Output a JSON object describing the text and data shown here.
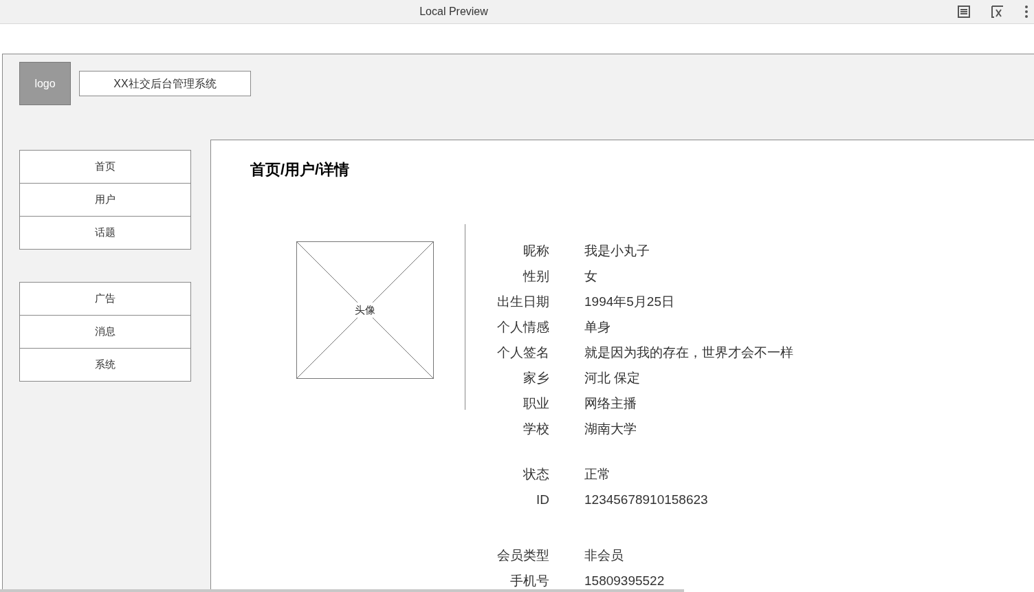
{
  "window": {
    "title": "Local Preview"
  },
  "header": {
    "logo": "logo",
    "system_name": "XX社交后台管理系统"
  },
  "sidebar": {
    "groups": [
      {
        "items": [
          {
            "label": "首页"
          },
          {
            "label": "用户"
          },
          {
            "label": "话题"
          }
        ]
      },
      {
        "items": [
          {
            "label": "广告"
          },
          {
            "label": "消息"
          },
          {
            "label": "系统"
          }
        ]
      }
    ]
  },
  "content": {
    "breadcrumb": "首页/用户/详情",
    "avatar_label": "头像",
    "field_groups": [
      {
        "fields": [
          {
            "label": "昵称",
            "value": "我是小丸子"
          },
          {
            "label": "性别",
            "value": "女"
          },
          {
            "label": "出生日期",
            "value": "1994年5月25日"
          },
          {
            "label": "个人情感",
            "value": "单身"
          },
          {
            "label": "个人签名",
            "value": "就是因为我的存在，世界才会不一样"
          },
          {
            "label": "家乡",
            "value": "河北 保定"
          },
          {
            "label": "职业",
            "value": "网络主播"
          },
          {
            "label": "学校",
            "value": "湖南大学"
          }
        ]
      },
      {
        "fields": [
          {
            "label": "状态",
            "value": "正常"
          },
          {
            "label": "ID",
            "value": "12345678910158623"
          }
        ]
      },
      {
        "fields": [
          {
            "label": "会员类型",
            "value": "非会员"
          },
          {
            "label": "手机号",
            "value": "15809395522"
          }
        ]
      }
    ]
  }
}
